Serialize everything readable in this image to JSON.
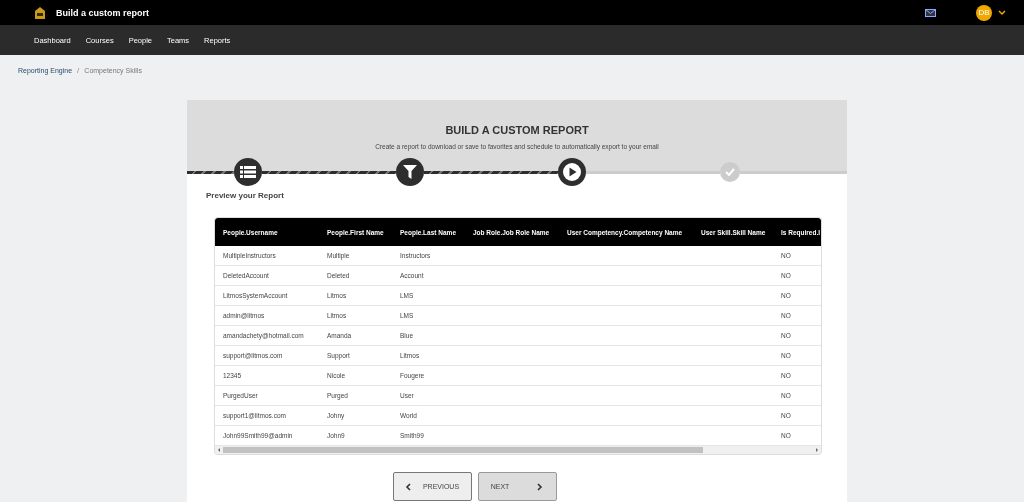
{
  "header": {
    "title": "Build a custom report",
    "avatar": "DB"
  },
  "nav": [
    "Dashboard",
    "Courses",
    "People",
    "Teams",
    "Reports"
  ],
  "breadcrumb": [
    "Reporting Engine",
    "Competency Skills"
  ],
  "breadcrumb_separator": "/",
  "card": {
    "title": "BUILD A CUSTOM REPORT",
    "subtitle": "Create a report to download or save to favorites and schedule to automatically export to your email"
  },
  "steps": [
    {
      "kind": "list",
      "done": true
    },
    {
      "kind": "filter",
      "done": true
    },
    {
      "kind": "play",
      "done": true
    },
    {
      "kind": "check",
      "done": false
    }
  ],
  "section_title": "Preview your Report",
  "table": {
    "columns": [
      "People.Username",
      "People.First Name",
      "People.Last Name",
      "Job Role.Job Role Name",
      "User Competency.Competency Name",
      "User Skill.Skill Name",
      "Is Required.I"
    ],
    "rows": [
      [
        "MultipleInstructors",
        "Multiple",
        "Instructors",
        "",
        "",
        "",
        "NO"
      ],
      [
        "DeletedAccount",
        "Deleted",
        "Account",
        "",
        "",
        "",
        "NO"
      ],
      [
        "LitmosSystemAccount",
        "Litmos",
        "LMS",
        "",
        "",
        "",
        "NO"
      ],
      [
        "admin@litmos",
        "Litmos",
        "LMS",
        "",
        "",
        "",
        "NO"
      ],
      [
        "amandachety@hotmail.com",
        "Amanda",
        "Blue",
        "",
        "",
        "",
        "NO"
      ],
      [
        "support@litmos.com",
        "Support",
        "Litmos",
        "",
        "",
        "",
        "NO"
      ],
      [
        "12345",
        "Nicole",
        "Fougere",
        "",
        "",
        "",
        "NO"
      ],
      [
        "PurgedUser",
        "Purged",
        "User",
        "",
        "",
        "",
        "NO"
      ],
      [
        "support1@litmos.com",
        "Johny",
        "World",
        "",
        "",
        "",
        "NO"
      ],
      [
        "John99Smith99@admin",
        "John9",
        "Smith99",
        "",
        "",
        "",
        "NO"
      ]
    ]
  },
  "buttons": [
    {
      "label": "PREVIOUS",
      "kind": "prev",
      "disabled": false
    },
    {
      "label": "NEXT",
      "kind": "next",
      "disabled": true
    }
  ]
}
